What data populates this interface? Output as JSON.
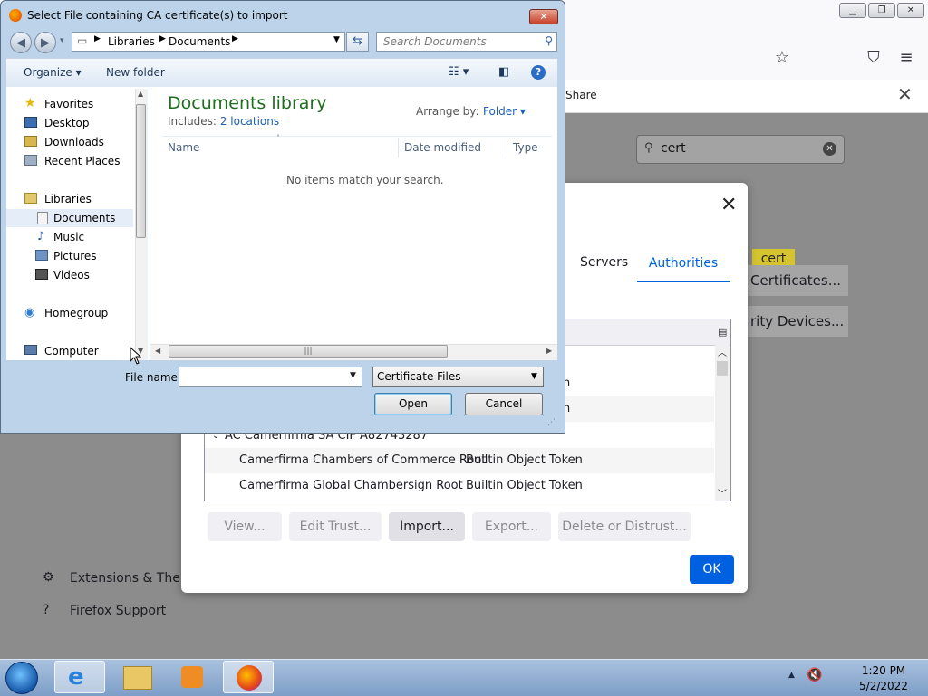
{
  "firefox": {
    "search_value": "cert",
    "notif_share": "Share",
    "sidebar": [
      "Extensions & Themes",
      "Firefox Support"
    ],
    "highlight_chip": "cert",
    "bg_buttons": [
      "Certificates...",
      "rity Devices..."
    ]
  },
  "cert_manager": {
    "tabs": [
      "Servers",
      "Authorities"
    ],
    "rows": [
      {
        "text": "AC Camerfirma SA CIF A82743287",
        "token": ""
      },
      {
        "text": "Camerfirma Chambers of Commerce Root",
        "token": "Builtin Object Token"
      },
      {
        "text": "Camerfirma Global Chambersign Root",
        "token": "Builtin Object Token"
      }
    ],
    "partial_rows": [
      "n",
      "n"
    ],
    "buttons": {
      "view": "View...",
      "edit_trust": "Edit Trust...",
      "import": "Import...",
      "export": "Export...",
      "delete": "Delete or Distrust..."
    },
    "ok": "OK"
  },
  "file_dialog": {
    "title": "Select File containing CA certificate(s) to import",
    "breadcrumb": [
      "Libraries",
      "Documents"
    ],
    "search_placeholder": "Search Documents",
    "organize": "Organize",
    "new_folder": "New folder",
    "nav": {
      "favorites": "Favorites",
      "desktop": "Desktop",
      "downloads": "Downloads",
      "recent": "Recent Places",
      "libraries": "Libraries",
      "documents": "Documents",
      "music": "Music",
      "pictures": "Pictures",
      "videos": "Videos",
      "homegroup": "Homegroup",
      "computer": "Computer"
    },
    "library_title": "Documents library",
    "includes_label": "Includes:",
    "includes_link": "2 locations",
    "arrange_label": "Arrange by:",
    "arrange_value": "Folder",
    "columns": [
      "Name",
      "Date modified",
      "Type"
    ],
    "empty_message": "No items match your search.",
    "file_name_label": "File name:",
    "file_name_value": "",
    "filter": "Certificate Files",
    "open": "Open",
    "cancel": "Cancel"
  },
  "taskbar": {
    "time": "1:20 PM",
    "date": "5/2/2022"
  }
}
